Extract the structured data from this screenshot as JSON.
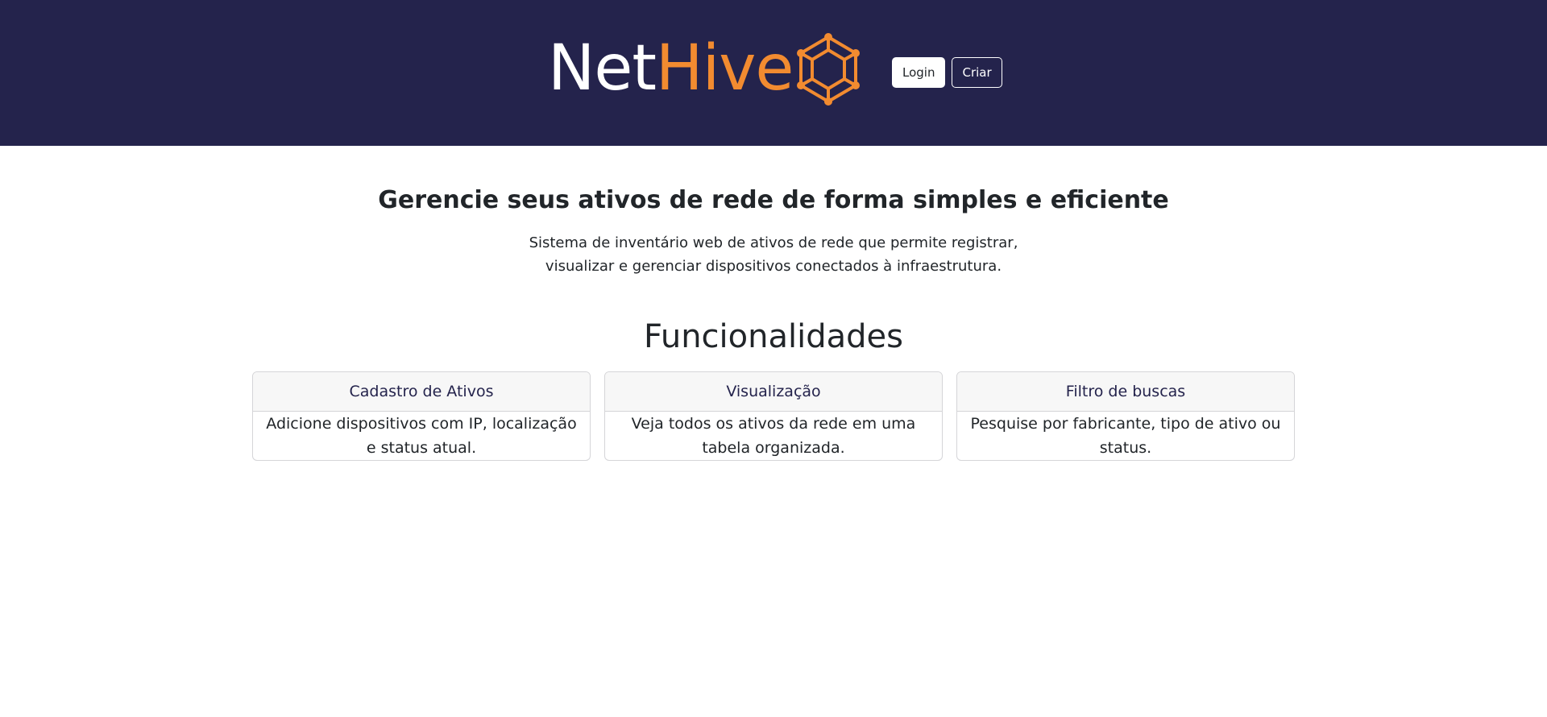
{
  "header": {
    "brand_part1": "Net",
    "brand_part2": "Hive",
    "logo_icon": "hexagon-network-icon",
    "login_label": "Login",
    "criar_label": "Criar"
  },
  "hero": {
    "title": "Gerencie seus ativos de rede de forma simples e eficiente",
    "description": "Sistema de inventário web de ativos de rede que permite registrar, visualizar e gerenciar dispositivos conectados à infraestrutura."
  },
  "features": {
    "title": "Funcionalidades",
    "cards": [
      {
        "title": "Cadastro de Ativos",
        "body": "Adicione dispositivos com IP, localização e status atual."
      },
      {
        "title": "Visualização",
        "body": "Veja todos os ativos da rede em uma tabela organizada."
      },
      {
        "title": "Filtro de buscas",
        "body": "Pesquise por fabricante, tipo de ativo ou status."
      }
    ]
  },
  "colors": {
    "header_bg": "#24234c",
    "brand_accent": "#f28b30",
    "card_header_bg": "#f7f7f7"
  }
}
